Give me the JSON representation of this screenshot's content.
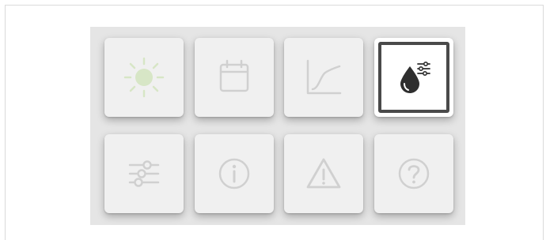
{
  "menu": {
    "tiles": [
      {
        "icon": "sun-icon",
        "active": false
      },
      {
        "icon": "calendar-icon",
        "active": false
      },
      {
        "icon": "chart-line-icon",
        "active": false
      },
      {
        "icon": "water-drop-settings-icon",
        "active": true
      },
      {
        "icon": "sliders-icon",
        "active": false
      },
      {
        "icon": "info-icon",
        "active": false
      },
      {
        "icon": "warning-icon",
        "active": false
      },
      {
        "icon": "help-icon",
        "active": false
      }
    ]
  },
  "colors": {
    "sun_accent": "#d7e6c6",
    "icon_muted": "#d0d0d0",
    "icon_active": "#2f2f2f",
    "selection_border": "#4a4a4a"
  }
}
